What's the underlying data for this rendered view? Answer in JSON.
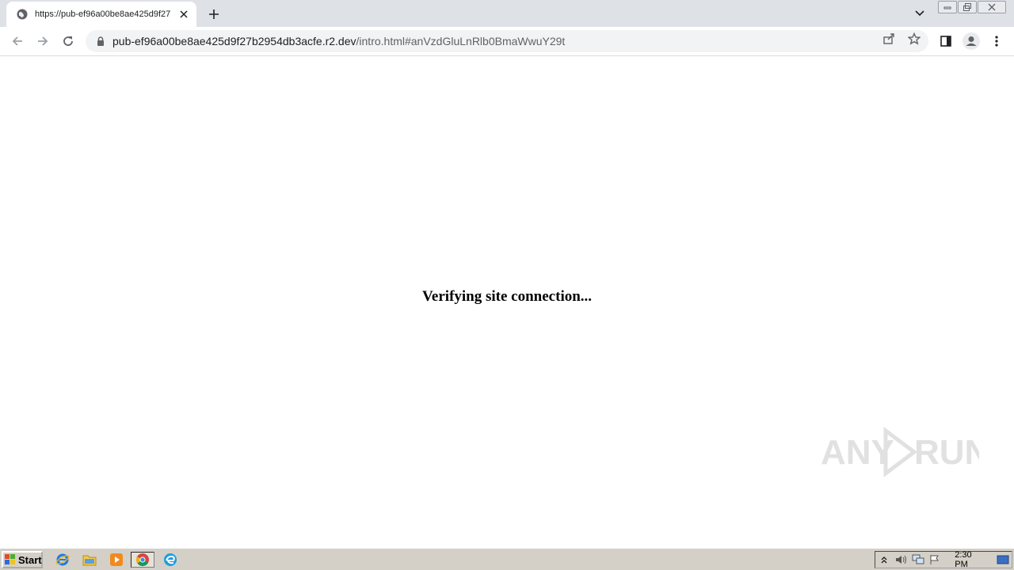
{
  "browser": {
    "tab": {
      "title": "https://pub-ef96a00be8ae425d9f27"
    },
    "address": {
      "host": "pub-ef96a00be8ae425d9f27b2954db3acfe.r2.dev",
      "path": "/intro.html#anVzdGluLnRlb0BmaWwuY29t"
    }
  },
  "page": {
    "message": "Verifying site connection..."
  },
  "watermark": {
    "text": "ANY RUN"
  },
  "taskbar": {
    "start_label": "Start",
    "clock": "2:30 PM"
  },
  "colors": {
    "tabstrip": "#dee1e6",
    "omnibox": "#f1f3f4",
    "taskbar": "#d4d0c8"
  }
}
